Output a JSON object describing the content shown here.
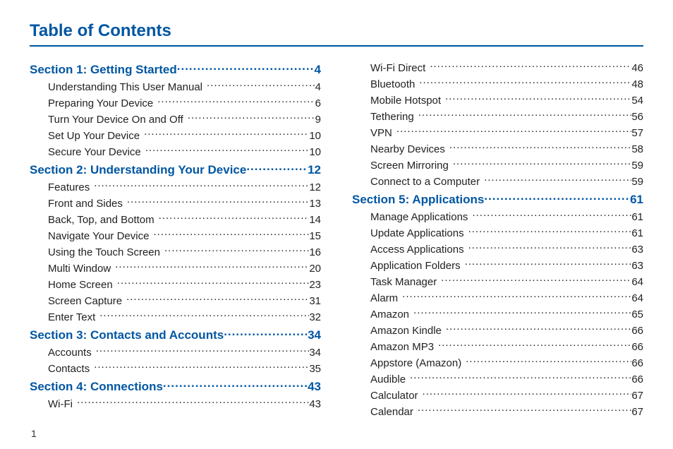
{
  "title": "Table of Contents",
  "page_number": "1",
  "columns": [
    [
      {
        "type": "section",
        "label": "Section 1:  Getting Started ",
        "page": "4"
      },
      {
        "type": "entry",
        "label": "Understanding This User Manual",
        "page": "4"
      },
      {
        "type": "entry",
        "label": "Preparing Your Device",
        "page": "6"
      },
      {
        "type": "entry",
        "label": "Turn Your Device On and Off",
        "page": "9"
      },
      {
        "type": "entry",
        "label": "Set Up Your Device",
        "page": "10"
      },
      {
        "type": "entry",
        "label": "Secure Your Device",
        "page": "10"
      },
      {
        "type": "section",
        "label": "Section 2:  Understanding Your Device ",
        "page": "12"
      },
      {
        "type": "entry",
        "label": "Features",
        "page": "12"
      },
      {
        "type": "entry",
        "label": "Front and Sides",
        "page": "13"
      },
      {
        "type": "entry",
        "label": "Back, Top, and Bottom",
        "page": "14"
      },
      {
        "type": "entry",
        "label": "Navigate Your Device",
        "page": "15"
      },
      {
        "type": "entry",
        "label": "Using the Touch Screen",
        "page": "16"
      },
      {
        "type": "entry",
        "label": "Multi Window",
        "page": "20"
      },
      {
        "type": "entry",
        "label": "Home Screen",
        "page": "23"
      },
      {
        "type": "entry",
        "label": "Screen Capture",
        "page": "31"
      },
      {
        "type": "entry",
        "label": "Enter Text",
        "page": "32"
      },
      {
        "type": "section",
        "label": "Section 3:  Contacts and Accounts ",
        "page": "34"
      },
      {
        "type": "entry",
        "label": "Accounts",
        "page": "34"
      },
      {
        "type": "entry",
        "label": "Contacts",
        "page": "35"
      },
      {
        "type": "section",
        "label": "Section 4:  Connections ",
        "page": "43"
      },
      {
        "type": "entry",
        "label": "Wi-Fi",
        "page": "43"
      }
    ],
    [
      {
        "type": "entry",
        "label": "Wi-Fi Direct",
        "page": "46"
      },
      {
        "type": "entry",
        "label": "Bluetooth",
        "page": "48"
      },
      {
        "type": "entry",
        "label": "Mobile Hotspot",
        "page": "54"
      },
      {
        "type": "entry",
        "label": "Tethering",
        "page": "56"
      },
      {
        "type": "entry",
        "label": "VPN",
        "page": "57"
      },
      {
        "type": "entry",
        "label": "Nearby Devices",
        "page": "58"
      },
      {
        "type": "entry",
        "label": "Screen Mirroring",
        "page": "59"
      },
      {
        "type": "entry",
        "label": "Connect to a Computer",
        "page": "59"
      },
      {
        "type": "section",
        "label": "Section 5:  Applications ",
        "page": "61"
      },
      {
        "type": "entry",
        "label": "Manage Applications",
        "page": "61"
      },
      {
        "type": "entry",
        "label": "Update Applications",
        "page": "61"
      },
      {
        "type": "entry",
        "label": "Access Applications",
        "page": "63"
      },
      {
        "type": "entry",
        "label": "Application Folders",
        "page": "63"
      },
      {
        "type": "entry",
        "label": "Task Manager",
        "page": "64"
      },
      {
        "type": "entry",
        "label": "Alarm",
        "page": "64"
      },
      {
        "type": "entry",
        "label": "Amazon",
        "page": "65"
      },
      {
        "type": "entry",
        "label": "Amazon Kindle",
        "page": "66"
      },
      {
        "type": "entry",
        "label": "Amazon MP3",
        "page": "66"
      },
      {
        "type": "entry",
        "label": "Appstore (Amazon)",
        "page": "66"
      },
      {
        "type": "entry",
        "label": "Audible",
        "page": "66"
      },
      {
        "type": "entry",
        "label": "Calculator",
        "page": "67"
      },
      {
        "type": "entry",
        "label": "Calendar",
        "page": "67"
      }
    ]
  ]
}
